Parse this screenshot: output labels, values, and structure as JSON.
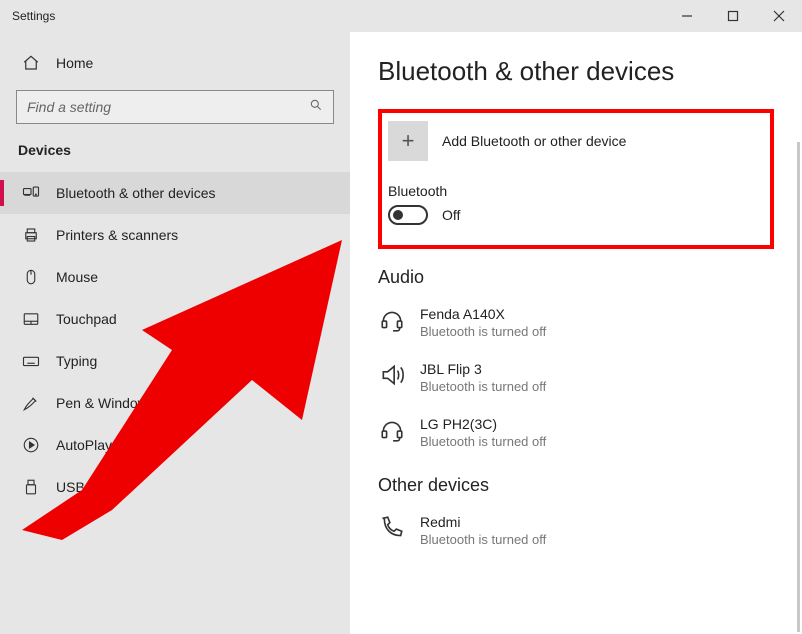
{
  "window": {
    "title": "Settings"
  },
  "sidebar": {
    "home": "Home",
    "searchPlaceholder": "Find a setting",
    "sectionHeader": "Devices",
    "items": [
      {
        "label": "Bluetooth & other devices"
      },
      {
        "label": "Printers & scanners"
      },
      {
        "label": "Mouse"
      },
      {
        "label": "Touchpad"
      },
      {
        "label": "Typing"
      },
      {
        "label": "Pen & Windows Ink"
      },
      {
        "label": "AutoPlay"
      },
      {
        "label": "USB"
      }
    ]
  },
  "content": {
    "heading": "Bluetooth & other devices",
    "addDevice": "Add Bluetooth or other device",
    "bluetoothLabel": "Bluetooth",
    "toggleState": "Off",
    "audioHeading": "Audio",
    "audioDevices": [
      {
        "name": "Fenda A140X",
        "status": "Bluetooth is turned off"
      },
      {
        "name": "JBL Flip 3",
        "status": "Bluetooth is turned off"
      },
      {
        "name": "LG PH2(3C)",
        "status": "Bluetooth is turned off"
      }
    ],
    "otherHeading": "Other devices",
    "otherDevices": [
      {
        "name": "Redmi",
        "status": "Bluetooth is turned off"
      }
    ]
  }
}
